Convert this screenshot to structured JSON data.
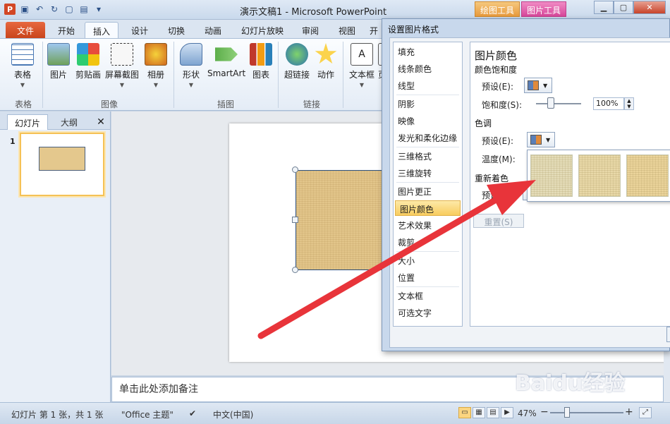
{
  "window": {
    "title": "演示文稿1 - Microsoft PowerPoint",
    "ctx_tab_draw": "绘图工具",
    "ctx_tab_picture": "图片工具"
  },
  "qat": {
    "logo": "P"
  },
  "tabs": [
    "文件",
    "开始",
    "插入",
    "设计",
    "切换",
    "动画",
    "幻灯片放映",
    "审阅",
    "视图",
    "开"
  ],
  "ribbon": {
    "buttons": [
      "表格",
      "图片",
      "剪贴画",
      "屏幕截图",
      "相册",
      "形状",
      "SmartArt",
      "图表",
      "超链接",
      "动作",
      "文本框",
      "页"
    ],
    "groups": [
      "表格",
      "图像",
      "插图",
      "链接"
    ]
  },
  "left_pane": {
    "tab_slides": "幻灯片",
    "tab_outline": "大纲",
    "close": "✕",
    "slide_number": "1"
  },
  "notes": {
    "placeholder": "单击此处添加备注"
  },
  "status": {
    "slide_info": "幻灯片 第 1 张，共 1 张",
    "theme": "\"Office 主题\"",
    "language": "中文(中国)",
    "zoom": "47%",
    "zoom_minus": "−",
    "zoom_plus": "+"
  },
  "dialog": {
    "title": "设置图片格式",
    "nav": [
      "填充",
      "线条颜色",
      "线型",
      "阴影",
      "映像",
      "发光和柔化边缘",
      "三维格式",
      "三维旋转",
      "图片更正",
      "图片颜色",
      "艺术效果",
      "裁剪",
      "大小",
      "位置",
      "文本框",
      "可选文字"
    ],
    "selected_nav": "图片颜色",
    "panel": {
      "heading": "图片颜色",
      "saturation_section": "颜色饱和度",
      "preset_label": "预设(E):",
      "saturation_label": "饱和度(S):",
      "saturation_value": "100%",
      "tone_section": "色调",
      "tone_preset_label": "预设(E):",
      "temperature_label": "温度(M):",
      "recolor_section": "重新着色",
      "recolor_preset_label": "预设",
      "reset_label": "重置(S)"
    },
    "swatch_colors": [
      "#e4dcb8",
      "#e8d8a8",
      "#ead39a"
    ]
  },
  "watermark": "Baidu经验",
  "colors": {
    "accent": "#d24726",
    "arrow": "#e8343a",
    "selection": "#f8cc5e"
  }
}
